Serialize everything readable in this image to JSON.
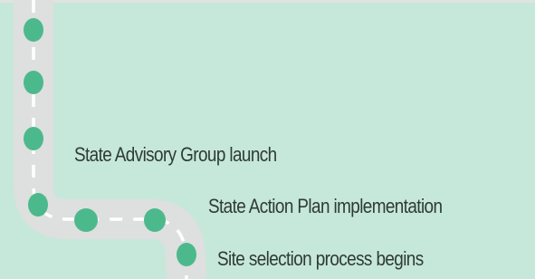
{
  "timeline": {
    "milestones": [
      {
        "label": "State Advisory Group launch"
      },
      {
        "label": "State Action Plan implementation"
      },
      {
        "label": "Site selection process begins"
      }
    ]
  },
  "colors": {
    "background": "#c6e8da",
    "road": "#dedfdf",
    "dash": "#ffffff",
    "marker": "#4cb98d",
    "text": "#2f3a36"
  }
}
